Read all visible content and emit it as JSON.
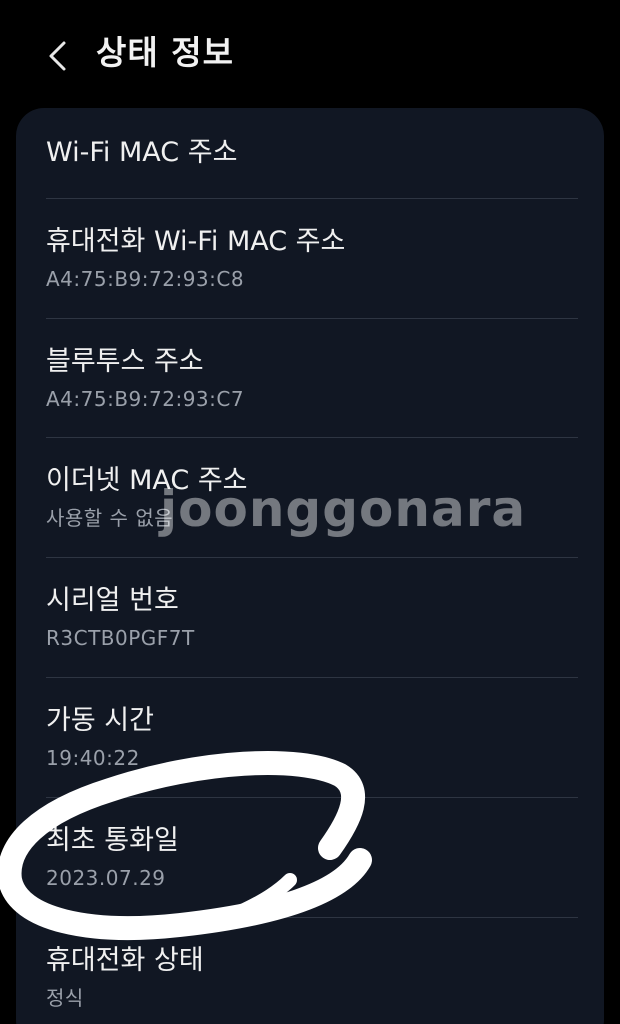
{
  "header": {
    "title": "상태 정보",
    "back_icon": "chevron-left-icon"
  },
  "items": [
    {
      "title": "Wi-Fi MAC 주소",
      "value": ""
    },
    {
      "title": "휴대전화 Wi-Fi MAC 주소",
      "value": "A4:75:B9:72:93:C8"
    },
    {
      "title": "블루투스 주소",
      "value": "A4:75:B9:72:93:C7"
    },
    {
      "title": "이더넷 MAC 주소",
      "value": "사용할 수 없음"
    },
    {
      "title": "시리얼 번호",
      "value": "R3CTB0PGF7T"
    },
    {
      "title": "가동 시간",
      "value": "19:40:22"
    },
    {
      "title": "최초 통화일",
      "value": "2023.07.29"
    },
    {
      "title": "휴대전화 상태",
      "value": "정식"
    }
  ],
  "watermark": "joonggonara",
  "colors": {
    "background": "#000000",
    "card": "#111723",
    "title_text": "#f0f0f0",
    "value_text": "#9aa0aa",
    "divider": "#2e3542"
  }
}
